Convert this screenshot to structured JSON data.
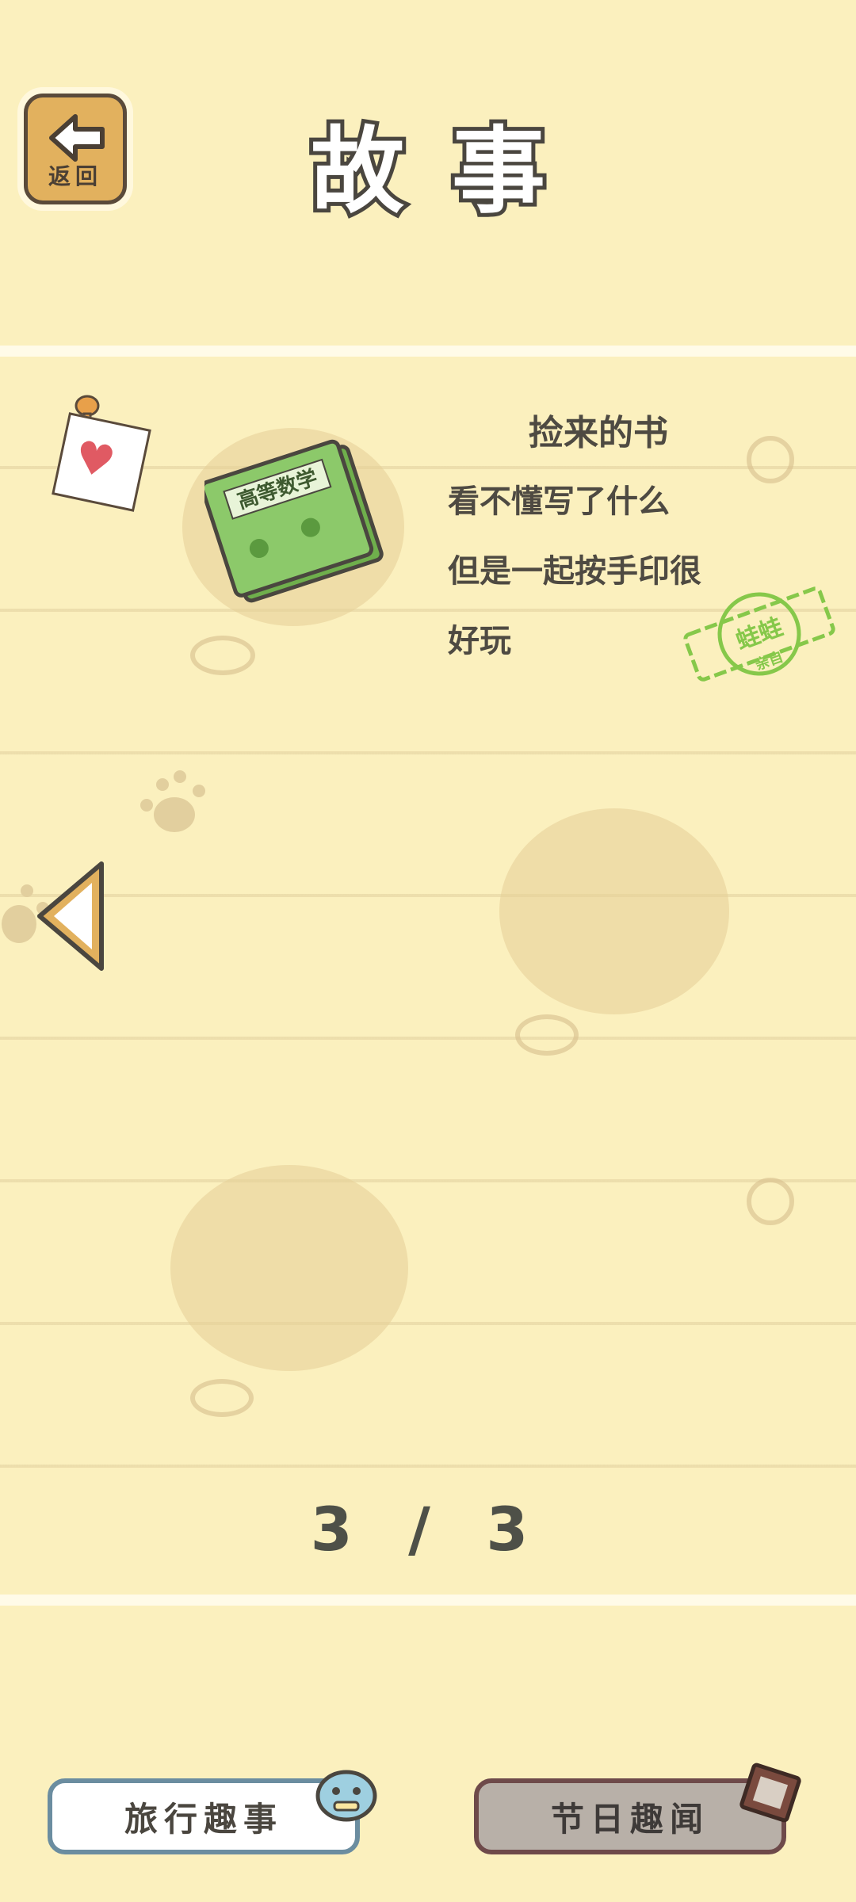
{
  "header": {
    "back_label": "返回",
    "title": "故事"
  },
  "story": {
    "title": "捡来的书",
    "lines": [
      "看不懂写了什么",
      "但是一起按手印很",
      "好玩"
    ],
    "book_cover_text": "高等数学",
    "stamp_text": "蛙蛙",
    "stamp_subtext": "亲自"
  },
  "pager": {
    "counter": "3 / 3"
  },
  "tabs": {
    "travel_label": "旅行趣事",
    "holiday_label": "节日趣闻"
  },
  "colors": {
    "background": "#FBF0BE",
    "book_green": "#8CC96A",
    "stamp_green": "#86C84A",
    "heart": "#E05A63"
  }
}
